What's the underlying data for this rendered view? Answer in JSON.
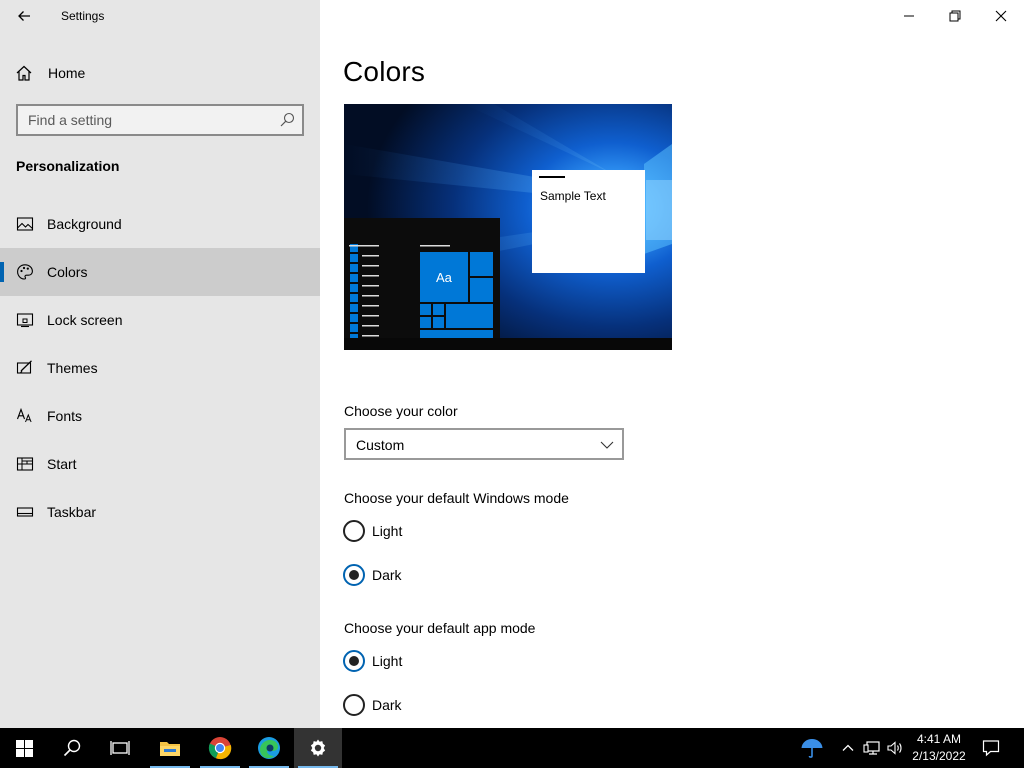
{
  "window": {
    "title": "Settings",
    "controls": [
      "minimize-icon",
      "restore-icon",
      "close-icon"
    ]
  },
  "sidebar": {
    "home_label": "Home",
    "search_placeholder": "Find a setting",
    "section_title": "Personalization",
    "items": [
      {
        "label": "Background",
        "icon": "picture-icon",
        "selected": false
      },
      {
        "label": "Colors",
        "icon": "palette-icon",
        "selected": true
      },
      {
        "label": "Lock screen",
        "icon": "lock-screen-icon",
        "selected": false
      },
      {
        "label": "Themes",
        "icon": "themes-icon",
        "selected": false
      },
      {
        "label": "Fonts",
        "icon": "fonts-icon",
        "selected": false
      },
      {
        "label": "Start",
        "icon": "start-icon",
        "selected": false
      },
      {
        "label": "Taskbar",
        "icon": "taskbar-icon",
        "selected": false
      }
    ]
  },
  "main": {
    "title": "Colors",
    "preview": {
      "sample_text": "Sample Text",
      "tile_text": "Aa",
      "accent_color": "#0078d7"
    },
    "choose_color": {
      "label": "Choose your color",
      "selected": "Custom"
    },
    "windows_mode": {
      "label": "Choose your default Windows mode",
      "options": [
        "Light",
        "Dark"
      ],
      "selected": "Dark"
    },
    "app_mode": {
      "label": "Choose your default app mode",
      "options": [
        "Light",
        "Dark"
      ],
      "selected": "Light"
    }
  },
  "taskbar": {
    "apps": [
      "start-icon",
      "search-icon",
      "task-view-icon",
      "file-explorer-icon",
      "chrome-icon",
      "edge-icon",
      "settings-icon"
    ],
    "active_app": "settings-icon",
    "tray": [
      "weather-umbrella-icon",
      "chevron-up-icon",
      "network-icon",
      "volume-icon",
      "notification-icon"
    ],
    "time": "4:41 AM",
    "date": "2/13/2022"
  },
  "colors": {
    "accent": "#0063b1",
    "sidebar_bg": "#e6e6e6",
    "selected_item_bg": "#cccccc",
    "taskbar_bg": "#000000"
  }
}
